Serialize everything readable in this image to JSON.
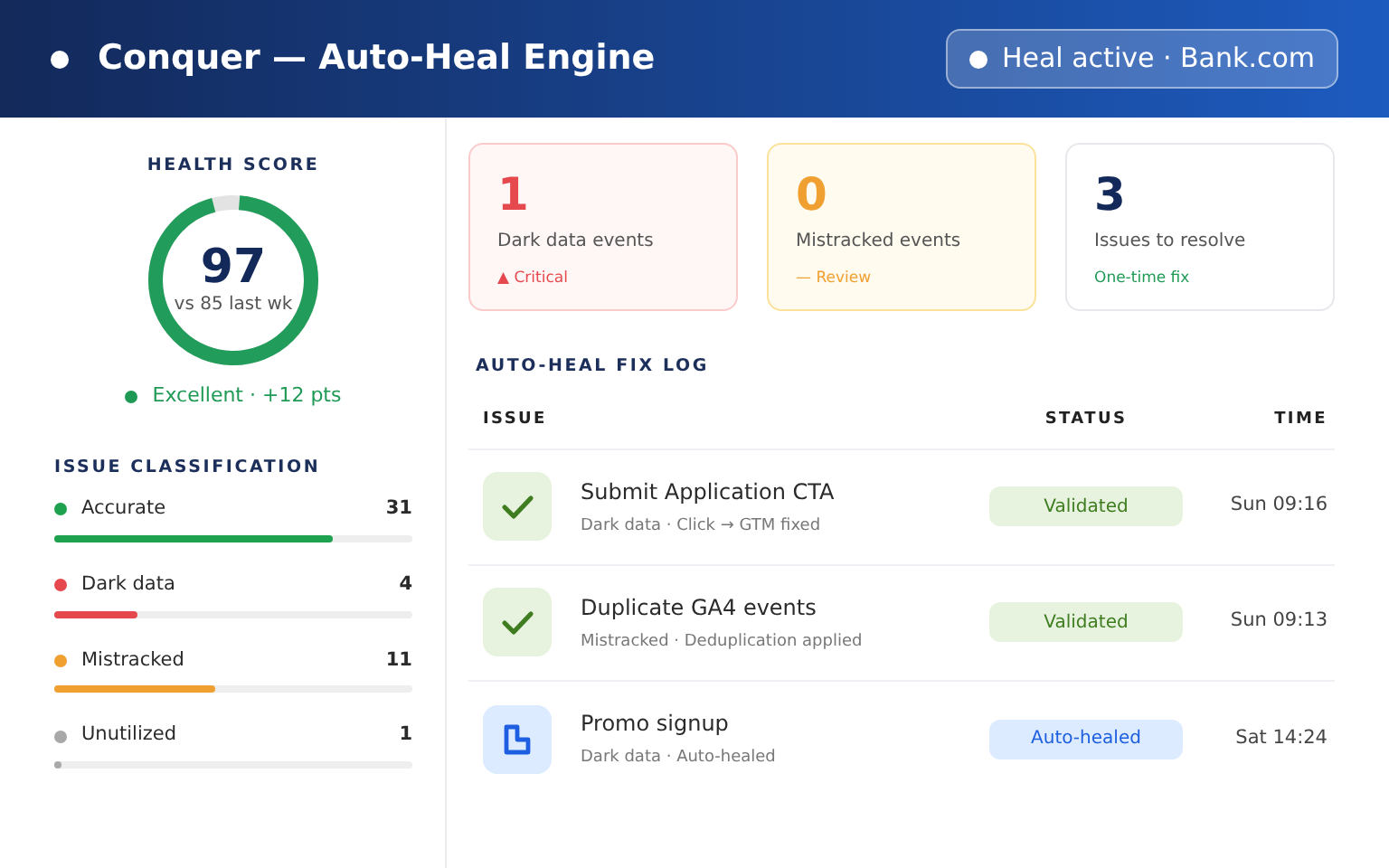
{
  "header": {
    "title": "Conquer — Auto-Heal Engine",
    "badge": "Heal active · Bank.com"
  },
  "health": {
    "title": "HEALTH SCORE",
    "score": "97",
    "comparison": "vs 85 last wk",
    "level": 0.97,
    "rating": "Excellent · +12 pts"
  },
  "classification": {
    "title": "ISSUE CLASSIFICATION",
    "items": [
      {
        "label": "Accurate",
        "count": "31",
        "color": "#1fa24f",
        "level": 0.78
      },
      {
        "label": "Dark data",
        "count": "4",
        "color": "#e5484d",
        "level": 0.23
      },
      {
        "label": "Mistracked",
        "count": "11",
        "color": "#f0a030",
        "level": 0.45
      },
      {
        "label": "Unutilized",
        "count": "1",
        "color": "#a8a8a8",
        "level": 0.02
      }
    ]
  },
  "cards": [
    {
      "kind": "critical",
      "value": "1",
      "label": "Dark data events",
      "note": "▲ Critical"
    },
    {
      "kind": "review",
      "value": "0",
      "label": "Mistracked events",
      "note": "— Review"
    },
    {
      "kind": "info",
      "value": "3",
      "label": "Issues to resolve",
      "note": "One-time fix"
    }
  ],
  "fix_log": {
    "title": "AUTO-HEAL FIX LOG",
    "columns": [
      "ISSUE",
      "STATUS",
      "TIME"
    ],
    "rows": [
      {
        "kind": "validated",
        "title": "Submit Application CTA",
        "detail": "Dark data · Click → GTM fixed",
        "status": "Validated",
        "time": "Sun 09:16"
      },
      {
        "kind": "validated",
        "title": "Duplicate GA4 events",
        "detail": "Mistracked · Deduplication applied",
        "status": "Validated",
        "time": "Sun 09:13"
      },
      {
        "kind": "healed",
        "title": "Promo signup",
        "detail": "Dark data · Auto-healed",
        "status": "Auto-healed",
        "time": "Sat 14:24"
      }
    ]
  }
}
